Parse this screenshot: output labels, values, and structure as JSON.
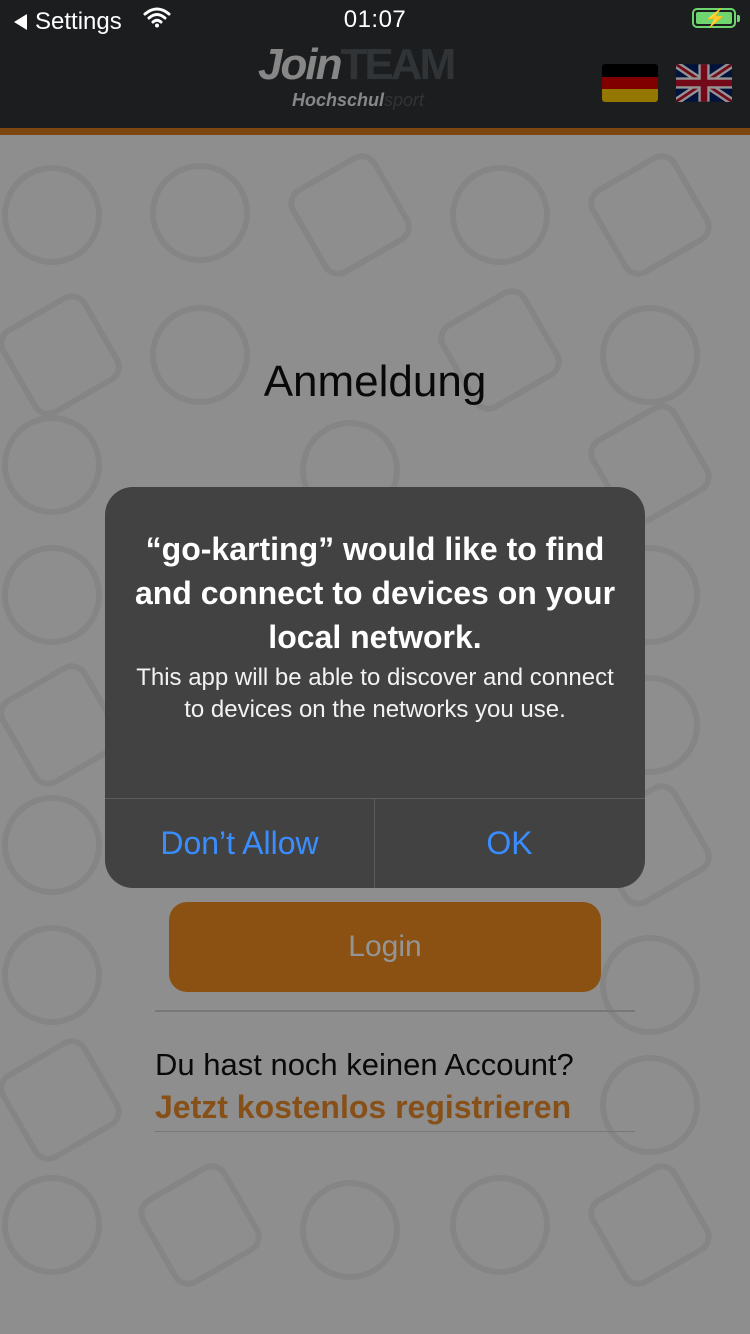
{
  "status_bar": {
    "back_label": "Settings",
    "time": "01:07"
  },
  "header": {
    "logo_join": "Join",
    "logo_team": "TEAM",
    "logo_hochschul": "Hochschul",
    "logo_sport": "sport",
    "accent_color": "#d7781a",
    "flags": [
      "german-flag",
      "uk-flag"
    ]
  },
  "page": {
    "title": "Anmeldung",
    "login_button": "Login",
    "no_account_text": "Du hast noch keinen Account?",
    "register_link": "Jetzt kostenlos registrieren"
  },
  "alert": {
    "title": "“go-karting” would like to find and connect to devices on your local network.",
    "message": "This app will be able to discover and connect to devices on the networks you use.",
    "deny_button": "Don’t Allow",
    "ok_button": "OK",
    "button_color": "#3a8dff"
  }
}
